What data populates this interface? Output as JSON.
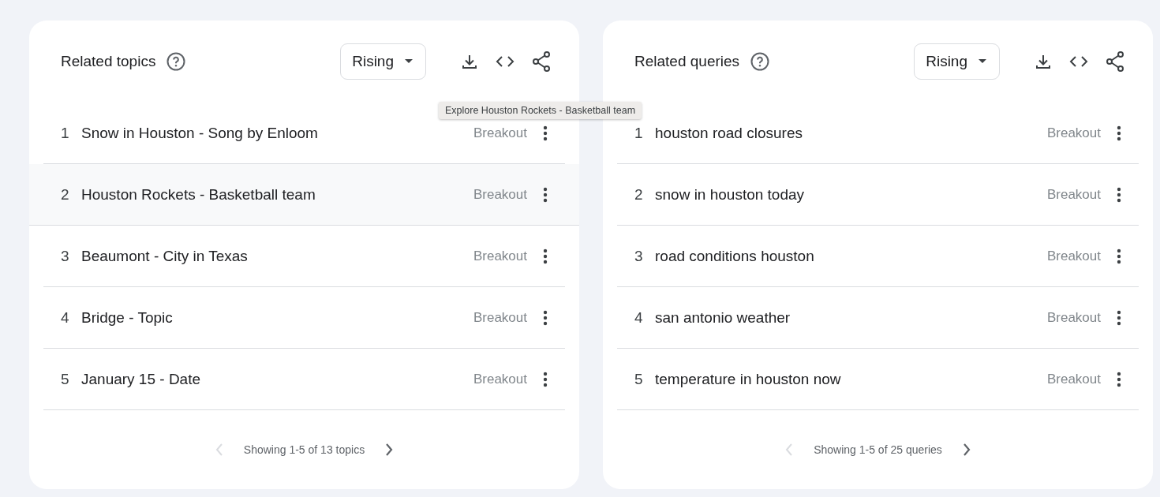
{
  "panels": [
    {
      "title": "Related topics",
      "filter": "Rising",
      "tooltip": "Explore Houston Rockets - Basketball team",
      "rows": [
        {
          "rank": "1",
          "label": "Snow in Houston - Song by Enloom",
          "value": "Breakout",
          "hovered": false
        },
        {
          "rank": "2",
          "label": "Houston Rockets - Basketball team",
          "value": "Breakout",
          "hovered": true
        },
        {
          "rank": "3",
          "label": "Beaumont - City in Texas",
          "value": "Breakout",
          "hovered": false
        },
        {
          "rank": "4",
          "label": "Bridge - Topic",
          "value": "Breakout",
          "hovered": false
        },
        {
          "rank": "5",
          "label": "January 15 - Date",
          "value": "Breakout",
          "hovered": false
        }
      ],
      "pager": {
        "text": "Showing 1-5 of 13 topics",
        "prev_disabled": true,
        "next_disabled": false
      }
    },
    {
      "title": "Related queries",
      "filter": "Rising",
      "rows": [
        {
          "rank": "1",
          "label": "houston road closures",
          "value": "Breakout",
          "hovered": false
        },
        {
          "rank": "2",
          "label": "snow in houston today",
          "value": "Breakout",
          "hovered": false
        },
        {
          "rank": "3",
          "label": "road conditions houston",
          "value": "Breakout",
          "hovered": false
        },
        {
          "rank": "4",
          "label": "san antonio weather",
          "value": "Breakout",
          "hovered": false
        },
        {
          "rank": "5",
          "label": "temperature in houston now",
          "value": "Breakout",
          "hovered": false
        }
      ],
      "pager": {
        "text": "Showing 1-5 of 25 queries",
        "prev_disabled": true,
        "next_disabled": false
      }
    }
  ]
}
